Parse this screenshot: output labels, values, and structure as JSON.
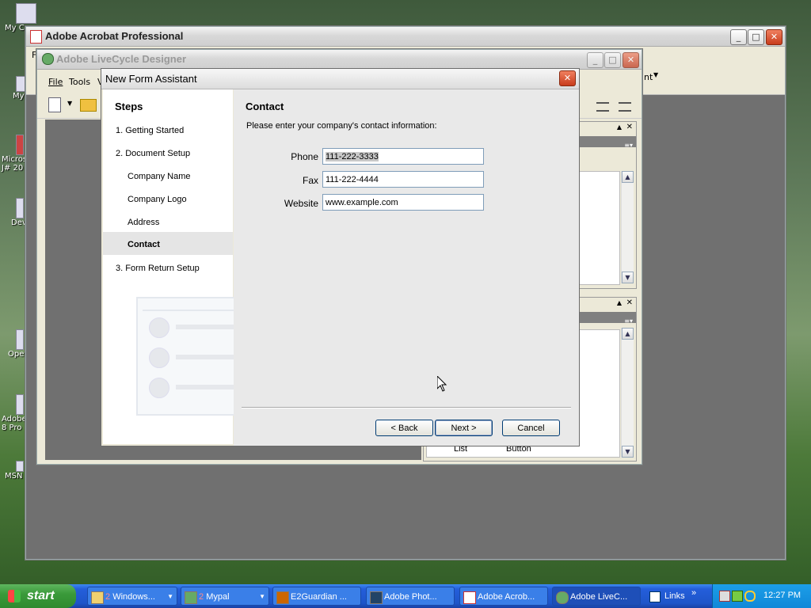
{
  "desktop": {
    "icons": [
      {
        "label": "My C"
      },
      {
        "label": "My"
      },
      {
        "label": "Micros J# 20"
      },
      {
        "label": "Dev"
      },
      {
        "label": "Ope"
      },
      {
        "label": "Adobe 8 Pro"
      },
      {
        "label": "MSN"
      }
    ]
  },
  "acrobat": {
    "title": "Adobe Acrobat Professional",
    "menu_partial": "F",
    "toolbar_partial": "nt"
  },
  "livecycle": {
    "title": "Adobe LiveCycle Designer",
    "menu": [
      "File",
      "Tools",
      "V"
    ],
    "list_label": "List",
    "button_label": "Button"
  },
  "dialog": {
    "title": "New Form Assistant",
    "steps_heading": "Steps",
    "steps": [
      {
        "label": "1. Getting Started",
        "indent": false,
        "selected": false
      },
      {
        "label": "2. Document Setup",
        "indent": false,
        "selected": false
      },
      {
        "label": "Company Name",
        "indent": true,
        "selected": false
      },
      {
        "label": "Company Logo",
        "indent": true,
        "selected": false
      },
      {
        "label": "Address",
        "indent": true,
        "selected": false
      },
      {
        "label": "Contact",
        "indent": true,
        "selected": true
      },
      {
        "label": "3. Form Return Setup",
        "indent": false,
        "selected": false
      }
    ],
    "section_title": "Contact",
    "instruction": "Please enter your company's contact information:",
    "fields": {
      "phone_label": "Phone",
      "phone_value": "111-222-3333",
      "fax_label": "Fax",
      "fax_value": "111-222-4444",
      "website_label": "Website",
      "website_value": "www.example.com"
    },
    "buttons": {
      "back": "< Back",
      "next": "Next >",
      "cancel": "Cancel"
    }
  },
  "taskbar": {
    "start_label": "start",
    "tasks": [
      {
        "label": "Windows...",
        "count": "2"
      },
      {
        "label": "Mypal",
        "count": "2"
      },
      {
        "label": "E2Guardian ..."
      },
      {
        "label": "Adobe Phot..."
      },
      {
        "label": "Adobe Acrob..."
      },
      {
        "label": "Adobe LiveC..."
      }
    ],
    "links_label": "Links",
    "clock": "12:27 PM"
  },
  "colors": {
    "taskbar_blue": "#245edb",
    "start_green": "#3a9a3a",
    "close_red": "#c83c1c"
  }
}
